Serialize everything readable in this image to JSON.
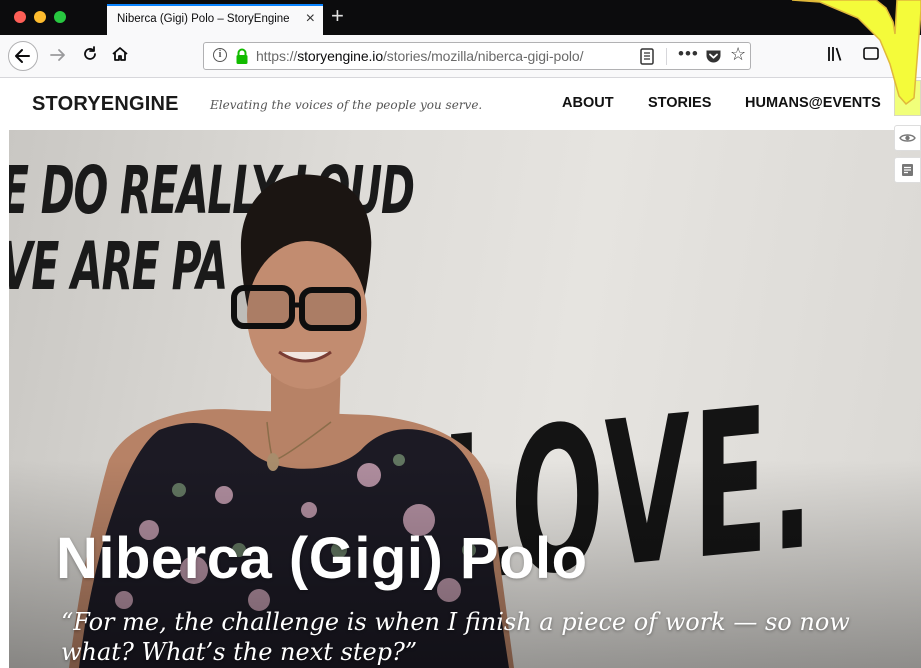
{
  "browser": {
    "tab_title": "Niberca (Gigi) Polo – StoryEngine",
    "tab_close": "×",
    "new_tab": "+",
    "url_prefix": "https://",
    "url_host": "storyengine.io",
    "url_path": "/stories/mozilla/niberca-gigi-polo/",
    "more_glyph": "•••",
    "star_glyph": "☆",
    "icons": [
      "back-icon",
      "forward-icon",
      "reload-icon",
      "home-icon",
      "info-icon",
      "lock-icon",
      "reader-view-icon",
      "more-icon",
      "pocket-icon",
      "star-icon",
      "library-icon",
      "sync-icon",
      "menu-icon"
    ]
  },
  "site": {
    "logo": "STORYENGINE",
    "tagline": "Elevating the voices of the people you serve.",
    "nav": [
      "ABOUT",
      "STORIES",
      "HUMANS@EVENTS"
    ]
  },
  "sidebar": {
    "chevron": "‹",
    "icons": [
      "eye-icon",
      "note-icon"
    ]
  },
  "hero": {
    "wall_line_1": "E DO REALLY LOUD",
    "wall_line_2": "VE ARE PA      T",
    "wall_love": "LOVE.",
    "title": "Niberca (Gigi) Polo",
    "quote": "“For me, the challenge is when I finish a piece of work — so now what? What’s the next step?”"
  },
  "colors": {
    "accent_tab": "#0a84ff",
    "lock_green": "#12bc00",
    "callout_yellow": "#f4fb3a",
    "sidebar_highlight": "#f1ff7a"
  }
}
